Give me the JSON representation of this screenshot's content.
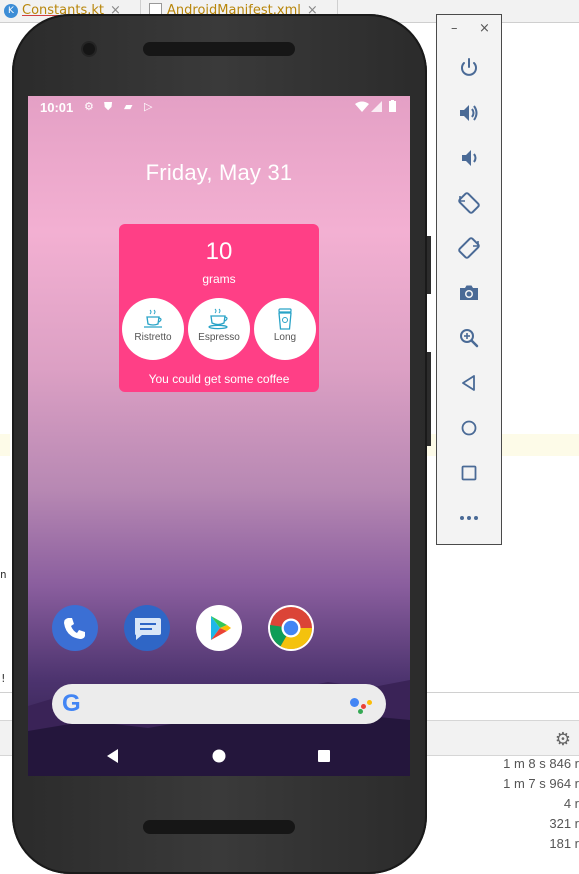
{
  "ide": {
    "tabs": [
      {
        "label": "Constants.kt",
        "close": "×"
      },
      {
        "label": "AndroidManifest.xml",
        "close": "×"
      }
    ],
    "fragments": [
      "n",
      "!"
    ],
    "timings": [
      "1 m 8 s 846 r",
      "1 m 7 s 964 r",
      "4 r",
      "321 r",
      "181 r"
    ]
  },
  "phone": {
    "status_bar": {
      "time": "10:01",
      "left_icons": [
        "settings-icon",
        "shield-icon",
        "sd-card-icon",
        "play-store-icon"
      ],
      "right_icons": [
        "wifi-icon",
        "signal-icon",
        "battery-icon"
      ]
    },
    "date": "Friday, May 31",
    "widget": {
      "count": "10",
      "unit": "grams",
      "buttons": [
        {
          "label": "Ristretto",
          "icon": "ristretto-cup-icon"
        },
        {
          "label": "Espresso",
          "icon": "espresso-cup-icon"
        },
        {
          "label": "Long",
          "icon": "long-cup-icon"
        }
      ],
      "status": "You could get some coffee",
      "color": "#ff3f86"
    },
    "dock": [
      {
        "name": "phone-app-icon",
        "color": "#3b6fd4"
      },
      {
        "name": "messages-app-icon",
        "color": "#2f66c6"
      },
      {
        "name": "play-store-app-icon",
        "color": "#ffffff"
      },
      {
        "name": "chrome-app-icon",
        "color": "#ffffff"
      }
    ],
    "search": {
      "logo": "google-g-icon",
      "assistant": "assistant-icon"
    },
    "nav": [
      "back-icon",
      "home-icon",
      "recents-icon"
    ]
  },
  "emulator_controls": {
    "window": {
      "minimize": "–",
      "close": "×"
    },
    "buttons": [
      "power-icon",
      "volume-up-icon",
      "volume-down-icon",
      "rotate-left-icon",
      "rotate-right-icon",
      "camera-icon",
      "zoom-icon",
      "back-icon",
      "home-icon",
      "overview-icon",
      "more-icon"
    ]
  }
}
